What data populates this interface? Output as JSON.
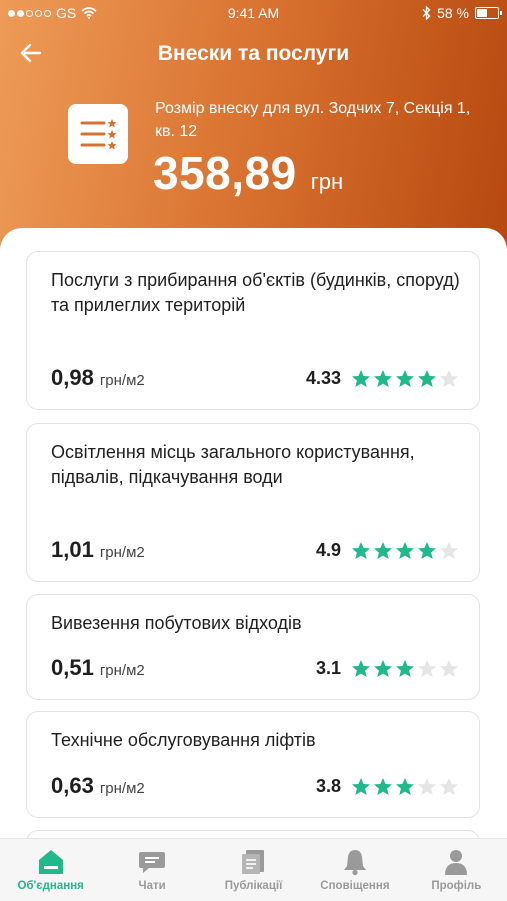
{
  "status_bar": {
    "carrier": "GS",
    "time": "9:41 AM",
    "battery": "58 %",
    "battery_level": 0.58
  },
  "header": {
    "title": "Внески та послуги",
    "address": "Розмір внеску для вул. Зодчих 7, Секція 1, кв. 12",
    "amount": "358,89",
    "currency": "грн"
  },
  "colors": {
    "accent_green": "#1fb98c",
    "header_orange": "#d8712f",
    "star_empty": "#e5e5e5"
  },
  "services": [
    {
      "title": "Послуги з прибирання об'єктів (будинків, споруд) та прилеглих територій",
      "price": "0,98",
      "unit": "грн/м2",
      "rating": "4.33",
      "stars_filled": 4
    },
    {
      "title": "Освітлення місць загального користування, підвалів, підкачування води",
      "price": "1,01",
      "unit": "грн/м2",
      "rating": "4.9",
      "stars_filled": 4
    },
    {
      "title": "Вивезення побутових відходів",
      "price": "0,51",
      "unit": "грн/м2",
      "rating": "3.1",
      "stars_filled": 3
    },
    {
      "title": "Технічне обслуговування ліфтів",
      "price": "0,63",
      "unit": "грн/м2",
      "rating": "3.8",
      "stars_filled": 3
    }
  ],
  "tabs": [
    {
      "label": "Об'єднання",
      "icon": "home-icon",
      "active": true
    },
    {
      "label": "Чати",
      "icon": "chat-icon",
      "active": false
    },
    {
      "label": "Публікації",
      "icon": "publications-icon",
      "active": false
    },
    {
      "label": "Сповіщення",
      "icon": "bell-icon",
      "active": false
    },
    {
      "label": "Профіль",
      "icon": "profile-icon",
      "active": false
    }
  ]
}
